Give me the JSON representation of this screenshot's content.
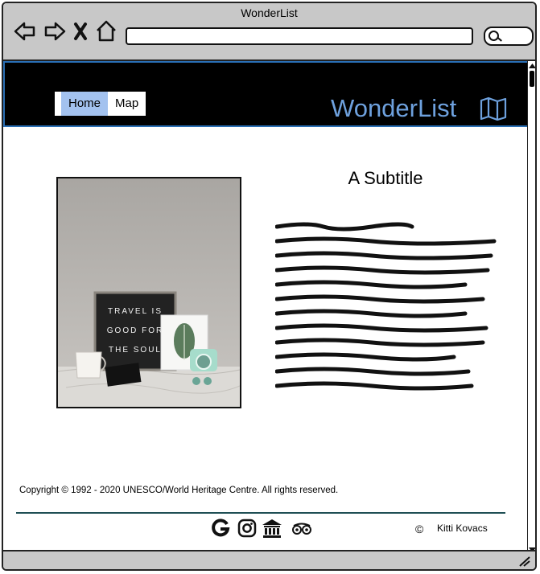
{
  "window": {
    "title": "WonderList"
  },
  "browser": {
    "address_value": "",
    "search_value": ""
  },
  "header": {
    "menu": [
      {
        "label": "Home",
        "active": true
      },
      {
        "label": "Map",
        "active": false
      }
    ],
    "brand": "WonderList",
    "brand_color": "#6ea1de",
    "active_tab_color": "#a3c2ef"
  },
  "main": {
    "subtitle": "A Subtitle",
    "photo": {
      "sign_lines": [
        "TRAVEL IS",
        "GOOD FOR",
        "THE SOUL"
      ]
    }
  },
  "footer": {
    "copyright": "Copyright © 1992 - 2020 UNESCO/World Heritage Centre. All rights reserved.",
    "social": [
      {
        "name": "google-icon",
        "glyph": "G"
      },
      {
        "name": "instagram-icon"
      },
      {
        "name": "museum-icon"
      },
      {
        "name": "tripadvisor-icon"
      }
    ],
    "author_symbol": "©",
    "author": "Kitti Kovacs"
  }
}
